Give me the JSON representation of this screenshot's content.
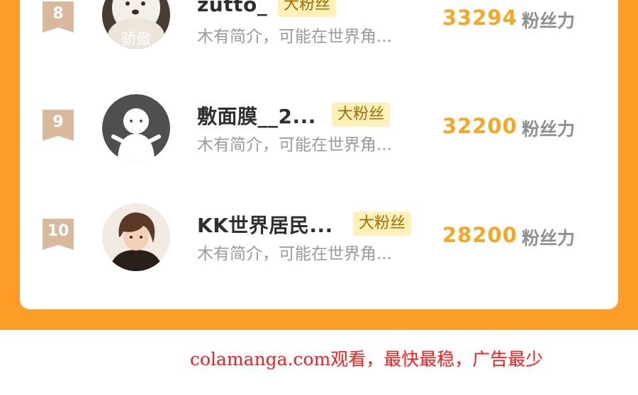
{
  "ranking": {
    "rows": [
      {
        "rank": "8",
        "name": "zutto_",
        "badge": "大粉丝",
        "description": "木有简介，可能在世界角...",
        "score": "33294",
        "score_unit": "粉丝力",
        "avatar_caption": "骄傲"
      },
      {
        "rank": "9",
        "name": "敷面膜__2...",
        "badge": "大粉丝",
        "description": "木有简介，可能在世界角...",
        "score": "32200",
        "score_unit": "粉丝力"
      },
      {
        "rank": "10",
        "name": "KK世界居民...",
        "badge": "大粉丝",
        "description": "木有简介，可能在世界角...",
        "score": "28200",
        "score_unit": "粉丝力"
      }
    ]
  },
  "footer": {
    "watermark": "colamanga.com观看，最快最稳，广告最少"
  },
  "colors": {
    "background_orange": "#fd9d28",
    "score": "#f5a623",
    "badge_bg": "#fff1b8",
    "footer_text": "#ff1a1a"
  }
}
